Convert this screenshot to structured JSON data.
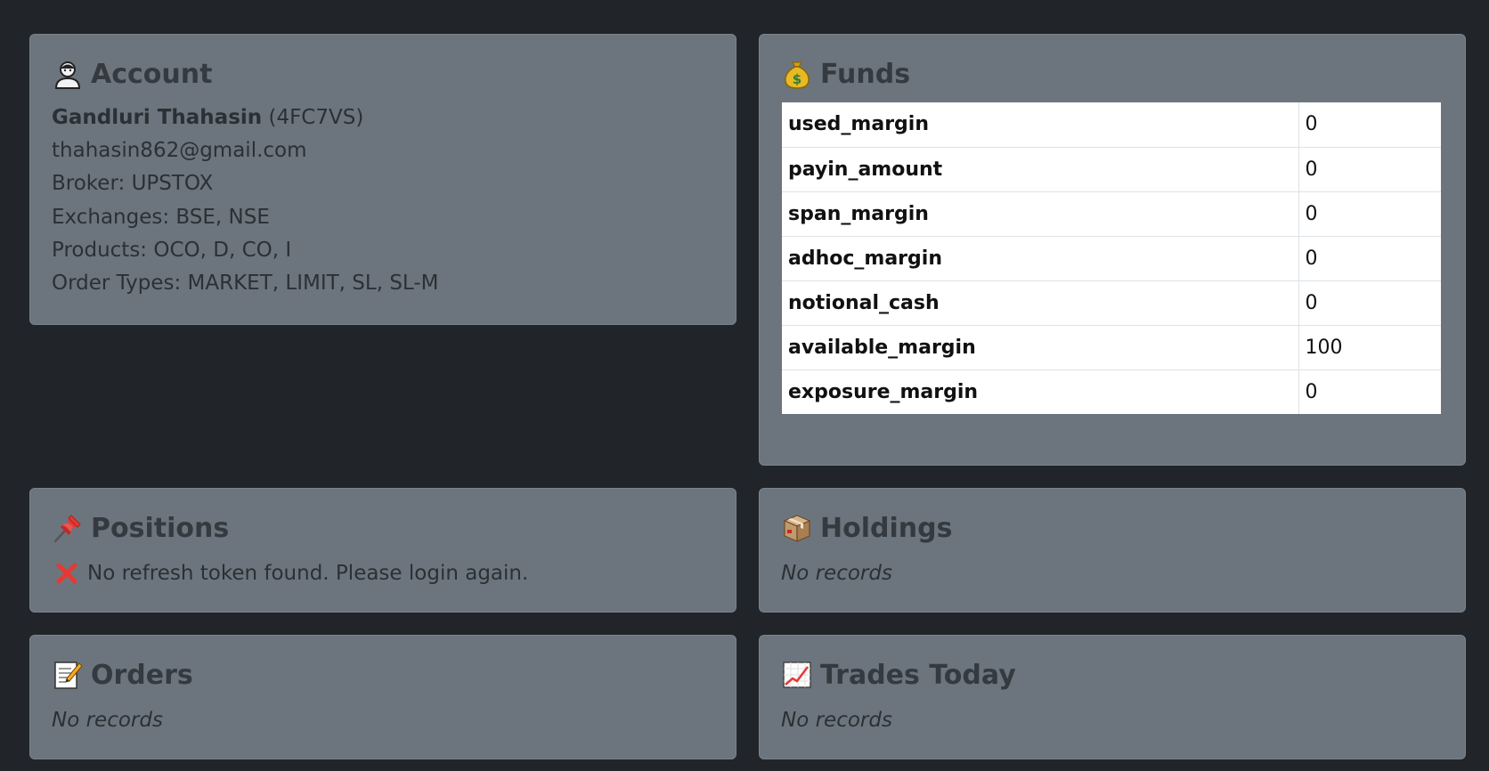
{
  "account": {
    "title": "Account",
    "icon": "user-icon",
    "name": "Gandluri Thahasin",
    "client_id": "(4FC7VS)",
    "email": "thahasin862@gmail.com",
    "broker": "Broker: UPSTOX",
    "exchanges": "Exchanges: BSE, NSE",
    "products": "Products: OCO, D, CO, I",
    "order_types": "Order Types: MARKET, LIMIT, SL, SL-M"
  },
  "funds": {
    "title": "Funds",
    "icon": "money-bag-icon",
    "rows": [
      {
        "key": "used_margin",
        "value": "0"
      },
      {
        "key": "payin_amount",
        "value": "0"
      },
      {
        "key": "span_margin",
        "value": "0"
      },
      {
        "key": "adhoc_margin",
        "value": "0"
      },
      {
        "key": "notional_cash",
        "value": "0"
      },
      {
        "key": "available_margin",
        "value": "100"
      },
      {
        "key": "exposure_margin",
        "value": "0"
      }
    ]
  },
  "positions": {
    "title": "Positions",
    "icon": "pushpin-icon",
    "error_icon": "cross-mark-icon",
    "message": "No refresh token found. Please login again."
  },
  "holdings": {
    "title": "Holdings",
    "icon": "package-icon",
    "message": "No records"
  },
  "orders": {
    "title": "Orders",
    "icon": "memo-icon",
    "message": "No records"
  },
  "trades": {
    "title": "Trades Today",
    "icon": "chart-increasing-icon",
    "message": "No records"
  },
  "colors": {
    "background": "#212529",
    "card": "#6c757d",
    "heading": "#343a40",
    "error": "#dc3545"
  }
}
